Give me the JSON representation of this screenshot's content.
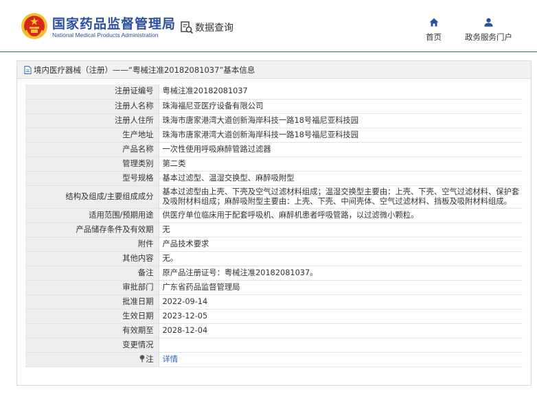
{
  "header": {
    "brand_cn": "国家药品监督管理局",
    "brand_en": "National Medical Products Administration",
    "query_label": "数据查询",
    "nav": [
      {
        "label": "首页",
        "icon": "home-icon"
      },
      {
        "label": "政务服务门户",
        "icon": "user-icon"
      }
    ]
  },
  "panel": {
    "title": "境内医疗器械（注册）——“粤械注准20182081037”基本信息"
  },
  "rows": [
    {
      "label": "注册证编号",
      "value": "粤械注准20182081037"
    },
    {
      "label": "注册人名称",
      "value": "珠海福尼亚医疗设备有限公司"
    },
    {
      "label": "注册人住所",
      "value": "珠海市唐家港湾大道创新海岸科技一路18号福尼亚科技园"
    },
    {
      "label": "生产地址",
      "value": "珠海市唐家港湾大道创新海岸科技一路18号福尼亚科技园"
    },
    {
      "label": "产品名称",
      "value": "一次性使用呼吸麻醉管路过滤器"
    },
    {
      "label": "管理类别",
      "value": "第二类"
    },
    {
      "label": "型号规格",
      "value": "基本过滤型、温湿交换型、麻醉吸附型"
    },
    {
      "label": "结构及组成/主要组成成分",
      "value": "基本过滤型由上壳、下壳及空气过滤材料组成；温湿交换型主要由：上壳、下壳、空气过滤材料、保护套及吸附材料组成；麻醉吸附型主要由：上壳、下壳、中间壳体、空气过滤材料、挡板及吸附材料组成。"
    },
    {
      "label": "适用范围/预期用途",
      "value": "供医疗单位临床用于配套呼吸机、麻醉机患者呼吸管路，以过滤微小颗粒。"
    },
    {
      "label": "产品储存条件及有效期",
      "value": "无"
    },
    {
      "label": "附件",
      "value": "产品技术要求"
    },
    {
      "label": "其他内容",
      "value": "无。"
    },
    {
      "label": "备注",
      "value": "原产品注册证号：粤械注准20182081037。"
    },
    {
      "label": "审批部门",
      "value": "广东省药品监督管理局"
    },
    {
      "label": "批准日期",
      "value": "2022-09-14"
    },
    {
      "label": "生效日期",
      "value": "2023-12-05"
    },
    {
      "label": "有效期至",
      "value": "2028-12-04"
    },
    {
      "label": "变更情况",
      "value": ""
    },
    {
      "label": "注",
      "value": "详情"
    }
  ],
  "colors": {
    "brand_blue": "#2a4f9e",
    "link_blue": "#2a63b8",
    "label_bg": "#eeeeee",
    "emblem_red": "#d8261d",
    "emblem_gold": "#f2c12e"
  }
}
